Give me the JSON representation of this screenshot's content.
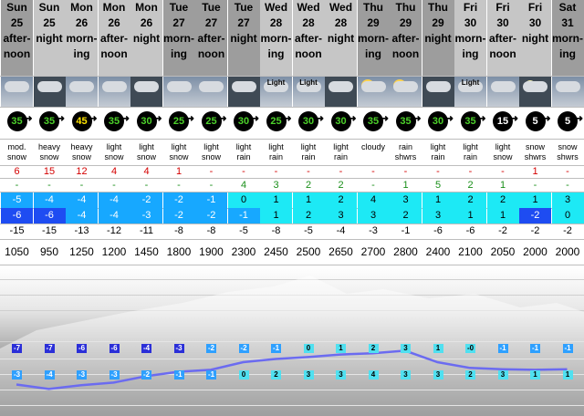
{
  "columns": [
    {
      "day": "Sun",
      "date": "25",
      "period": "after-\nnoon",
      "wx_label": "",
      "wind": "35",
      "wind_style": "g",
      "desc": "mod.\nsnow",
      "snow": "6",
      "rain": "-",
      "max": "-5",
      "min": "-6",
      "chill": "-15",
      "level": "1050"
    },
    {
      "day": "Sun",
      "date": "25",
      "period": "night",
      "wx_label": "",
      "wind": "35",
      "wind_style": "g",
      "desc": "heavy\nsnow",
      "snow": "15",
      "rain": "-",
      "max": "-4",
      "min": "-6",
      "chill": "-15",
      "level": "950"
    },
    {
      "day": "Mon",
      "date": "26",
      "period": "morn-\ning",
      "wx_label": "",
      "wind": "45",
      "wind_style": "y",
      "desc": "heavy\nsnow",
      "snow": "12",
      "rain": "-",
      "max": "-4",
      "min": "-4",
      "chill": "-13",
      "level": "1250"
    },
    {
      "day": "Mon",
      "date": "26",
      "period": "after-\nnoon",
      "wx_label": "",
      "wind": "35",
      "wind_style": "g",
      "desc": "light\nsnow",
      "snow": "4",
      "rain": "-",
      "max": "-4",
      "min": "-4",
      "chill": "-12",
      "level": "1200"
    },
    {
      "day": "Mon",
      "date": "26",
      "period": "night",
      "wx_label": "",
      "wind": "30",
      "wind_style": "g",
      "desc": "light\nsnow",
      "snow": "4",
      "rain": "-",
      "max": "-2",
      "min": "-3",
      "chill": "-11",
      "level": "1450"
    },
    {
      "day": "Tue",
      "date": "27",
      "period": "morn-\ning",
      "wx_label": "",
      "wind": "25",
      "wind_style": "g",
      "desc": "light\nsnow",
      "snow": "1",
      "rain": "-",
      "max": "-2",
      "min": "-2",
      "chill": "-8",
      "level": "1800"
    },
    {
      "day": "Tue",
      "date": "27",
      "period": "after-\nnoon",
      "wx_label": "",
      "wind": "25",
      "wind_style": "g",
      "desc": "light\nsnow",
      "snow": "-",
      "rain": "-",
      "max": "-1",
      "min": "-2",
      "chill": "-8",
      "level": "1900"
    },
    {
      "day": "Tue",
      "date": "27",
      "period": "night",
      "wx_label": "",
      "wind": "30",
      "wind_style": "g",
      "desc": "light\nrain",
      "snow": "-",
      "rain": "4",
      "max": "0",
      "min": "-1",
      "chill": "-5",
      "level": "2300"
    },
    {
      "day": "Wed",
      "date": "28",
      "period": "morn-\ning",
      "wx_label": "Light",
      "wind": "25",
      "wind_style": "g",
      "desc": "light\nrain",
      "snow": "-",
      "rain": "3",
      "max": "1",
      "min": "1",
      "chill": "-8",
      "level": "2450"
    },
    {
      "day": "Wed",
      "date": "28",
      "period": "after-\nnoon",
      "wx_label": "Light",
      "wind": "30",
      "wind_style": "g",
      "desc": "light\nrain",
      "snow": "-",
      "rain": "2",
      "max": "1",
      "min": "2",
      "chill": "-5",
      "level": "2500"
    },
    {
      "day": "Wed",
      "date": "28",
      "period": "night",
      "wx_label": "",
      "wind": "30",
      "wind_style": "g",
      "desc": "light\nrain",
      "snow": "-",
      "rain": "2",
      "max": "2",
      "min": "3",
      "chill": "-4",
      "level": "2650"
    },
    {
      "day": "Thu",
      "date": "29",
      "period": "morn-\ning",
      "wx_label": "",
      "wind": "35",
      "wind_style": "g",
      "desc": "cloudy",
      "snow": "-",
      "rain": "-",
      "max": "4",
      "min": "3",
      "chill": "-3",
      "level": "2700"
    },
    {
      "day": "Thu",
      "date": "29",
      "period": "after-\nnoon",
      "wx_label": "",
      "wind": "35",
      "wind_style": "g",
      "desc": "rain\nshwrs",
      "snow": "-",
      "rain": "1",
      "max": "3",
      "min": "2",
      "chill": "-1",
      "level": "2800"
    },
    {
      "day": "Thu",
      "date": "29",
      "period": "night",
      "wx_label": "",
      "wind": "30",
      "wind_style": "g",
      "desc": "light\nrain",
      "snow": "-",
      "rain": "5",
      "max": "1",
      "min": "3",
      "chill": "-6",
      "level": "2400"
    },
    {
      "day": "Fri",
      "date": "30",
      "period": "morn-\ning",
      "wx_label": "Light",
      "wind": "35",
      "wind_style": "g",
      "desc": "light\nrain",
      "snow": "-",
      "rain": "2",
      "max": "2",
      "min": "1",
      "chill": "-6",
      "level": "2100"
    },
    {
      "day": "Fri",
      "date": "30",
      "period": "after-\nnoon",
      "wx_label": "",
      "wind": "15",
      "wind_style": "w",
      "desc": "light\nsnow",
      "snow": "-",
      "rain": "1",
      "max": "2",
      "min": "1",
      "chill": "-2",
      "level": "2050"
    },
    {
      "day": "Fri",
      "date": "30",
      "period": "night",
      "wx_label": "",
      "wind": "5",
      "wind_style": "w",
      "desc": "snow\nshwrs",
      "snow": "1",
      "rain": "-",
      "max": "1",
      "min": "-2",
      "chill": "-2",
      "level": "2000"
    },
    {
      "day": "Sat",
      "date": "31",
      "period": "morn-\ning",
      "wx_label": "",
      "wind": "5",
      "wind_style": "w",
      "desc": "snow\nshwrs",
      "snow": "-",
      "rain": "-",
      "max": "3",
      "min": "0",
      "chill": "-2",
      "level": "2000"
    }
  ],
  "chart": {
    "upper": [
      "-7",
      "-7",
      "-6",
      "-6",
      "-4",
      "-3",
      "-2",
      "-2",
      "-1",
      "0",
      "1",
      "2",
      "3",
      "1",
      "-0",
      "-1",
      "-1",
      "-1"
    ],
    "lower": [
      "-3",
      "-4",
      "-3",
      "-3",
      "-2",
      "-1",
      "-1",
      "0",
      "2",
      "3",
      "3",
      "4",
      "3",
      "3",
      "2",
      "3",
      "1",
      "1"
    ],
    "line_values": [
      -2.5,
      -3.2,
      -2.6,
      -2.2,
      -1.2,
      -0.5,
      -0.2,
      1.0,
      1.5,
      1.8,
      2.2,
      2.4,
      2.8,
      1.0,
      0.1,
      -0.1,
      -0.2,
      -0.1
    ]
  },
  "colors": {
    "header_light": "#c6c6c6",
    "header_dark": "#9d9d9d",
    "freeze_pos": "#1de9f5",
    "freeze_neg": "#1e4cf2",
    "line": "#6b6bf0"
  }
}
